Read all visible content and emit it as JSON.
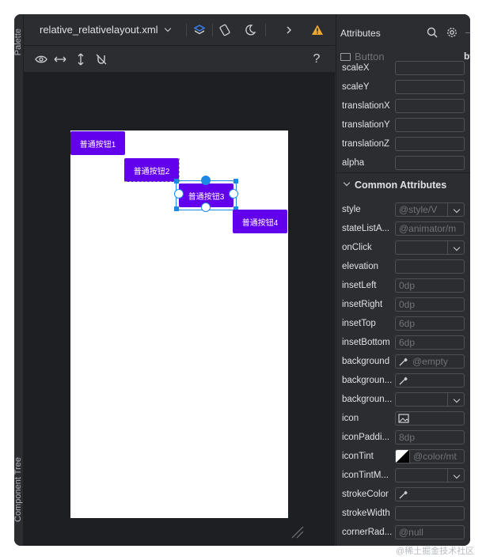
{
  "left_strip": {
    "palette": "Palette",
    "component_tree": "Component Tree"
  },
  "editor": {
    "file_name": "relative_relativelayout.xml",
    "buttons": [
      "普通按钮1",
      "普通按钮2",
      "普通按钮3",
      "普通按钮4"
    ]
  },
  "toolbar_icons": [
    "layers-icon",
    "rotate-icon",
    "night-mode-icon",
    "chevron-right-icon",
    "warning-icon"
  ],
  "design_toolbar_icons": [
    "eye-icon",
    "arrows-horizontal-icon",
    "arrows-vertical-icon",
    "magnet-off-icon",
    "help-icon"
  ],
  "attributes": {
    "title": "Attributes",
    "component_type": "Button",
    "component_id": "bt",
    "section_title": "Common Attributes",
    "transform_rows": [
      {
        "label": "scaleX",
        "value": ""
      },
      {
        "label": "scaleY",
        "value": ""
      },
      {
        "label": "translationX",
        "value": ""
      },
      {
        "label": "translationY",
        "value": ""
      },
      {
        "label": "translationZ",
        "value": ""
      },
      {
        "label": "alpha",
        "value": ""
      }
    ],
    "common_rows": [
      {
        "label": "style",
        "value": "@style/V",
        "type": "dropdown"
      },
      {
        "label": "stateListA...",
        "value": "@animator/m",
        "type": "text"
      },
      {
        "label": "onClick",
        "value": "",
        "type": "dropdown"
      },
      {
        "label": "elevation",
        "value": "",
        "type": "text"
      },
      {
        "label": "insetLeft",
        "value": "0dp",
        "type": "text"
      },
      {
        "label": "insetRight",
        "value": "0dp",
        "type": "text"
      },
      {
        "label": "insetTop",
        "value": "6dp",
        "type": "text"
      },
      {
        "label": "insetBottom",
        "value": "6dp",
        "type": "text"
      },
      {
        "label": "background",
        "value": "@empty",
        "type": "picker"
      },
      {
        "label": "backgroun...",
        "value": "",
        "type": "picker"
      },
      {
        "label": "backgroun...",
        "value": "",
        "type": "dropdown"
      },
      {
        "label": "icon",
        "value": "",
        "type": "image"
      },
      {
        "label": "iconPaddi...",
        "value": "8dp",
        "type": "text"
      },
      {
        "label": "iconTint",
        "value": "@color/mt",
        "type": "color"
      },
      {
        "label": "iconTintM...",
        "value": "",
        "type": "dropdown"
      },
      {
        "label": "strokeColor",
        "value": "",
        "type": "picker"
      },
      {
        "label": "strokeWidth",
        "value": "",
        "type": "text"
      },
      {
        "label": "cornerRad...",
        "value": "@null",
        "type": "text"
      }
    ]
  },
  "watermark": "@稀土掘金技术社区"
}
